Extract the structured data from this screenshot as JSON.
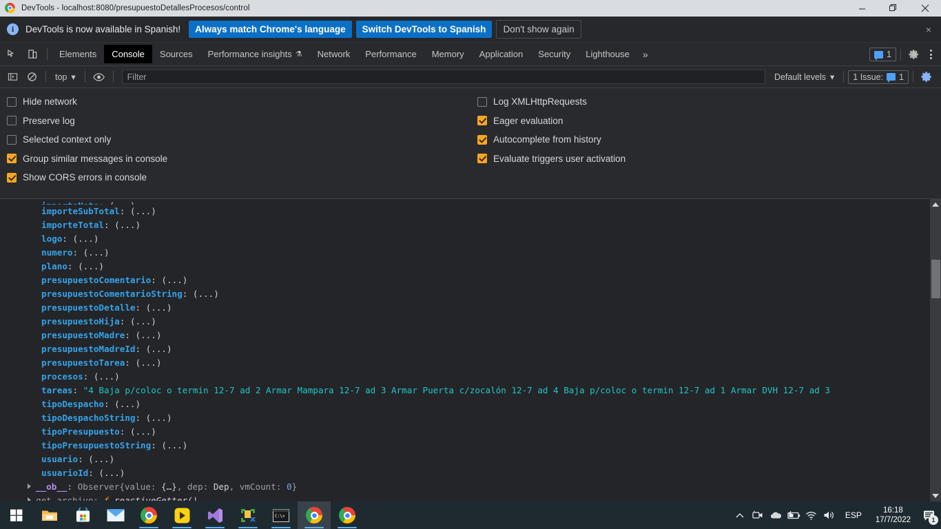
{
  "window": {
    "title": "DevTools - localhost:8080/presupuestoDetallesProcesos/control",
    "minimize_label": "Minimize",
    "restore_label": "Restore",
    "close_label": "Close"
  },
  "banner": {
    "icon": "info-icon",
    "message": "DevTools is now available in Spanish!",
    "primary_button": "Always match Chrome's language",
    "secondary_button": "Switch DevTools to Spanish",
    "dismiss_button": "Don't show again",
    "close_label": "×"
  },
  "tabbar": {
    "inspect_icon": "inspect-element-icon",
    "device_icon": "device-toolbar-icon",
    "tabs": [
      {
        "label": "Elements",
        "active": false
      },
      {
        "label": "Console",
        "active": true
      },
      {
        "label": "Sources",
        "active": false
      },
      {
        "label": "Performance insights",
        "active": false,
        "badge": "⚗"
      },
      {
        "label": "Network",
        "active": false
      },
      {
        "label": "Performance",
        "active": false
      },
      {
        "label": "Memory",
        "active": false
      },
      {
        "label": "Application",
        "active": false
      },
      {
        "label": "Security",
        "active": false
      },
      {
        "label": "Lighthouse",
        "active": false
      }
    ],
    "more_tabs": "»",
    "issue_count": "1",
    "settings_icon": "gear-icon",
    "more_options_icon": "kebab-menu-icon"
  },
  "console_toolbar": {
    "sidebar_icon": "console-sidebar-icon",
    "clear_icon": "clear-console-icon",
    "context": "top",
    "context_caret": "▾",
    "eye_icon": "live-expression-eye-icon",
    "filter_placeholder": "Filter",
    "filter_value": "",
    "levels_label": "Default levels",
    "levels_caret": "▾",
    "issues_label": "1 Issue:",
    "issues_count": "1",
    "settings_icon": "console-settings-gear-icon"
  },
  "settings_panel": {
    "left_column": [
      {
        "label": "Hide network",
        "checked": false
      },
      {
        "label": "Preserve log",
        "checked": false
      },
      {
        "label": "Selected context only",
        "checked": false
      },
      {
        "label": "Group similar messages in console",
        "checked": true
      },
      {
        "label": "Show CORS errors in console",
        "checked": true
      }
    ],
    "right_column": [
      {
        "label": "Log XMLHttpRequests",
        "checked": false
      },
      {
        "label": "Eager evaluation",
        "checked": true
      },
      {
        "label": "Autocomplete from history",
        "checked": true
      },
      {
        "label": "Evaluate triggers user activation",
        "checked": true
      }
    ]
  },
  "console_output": {
    "properties": [
      "importeSubTotal",
      "importeTotal",
      "logo",
      "numero",
      "plano",
      "presupuestoComentario",
      "presupuestoComentarioString",
      "presupuestoDetalle",
      "presupuestoHija",
      "presupuestoMadre",
      "presupuestoMadreId",
      "presupuestoTarea",
      "procesos"
    ],
    "collapsed_value": "(...)",
    "tareas_key": "tareas",
    "tareas_value": "\"4 Baja p/coloc o termin 12-7 ad 2 Armar Mampara 12-7 ad 3 Armar Puerta c/zocalón 12-7 ad 4 Baja p/coloc o termin 12-7 ad 1 Armar DVH 12-7 ad 3",
    "properties_after": [
      "tipoDespacho",
      "tipoDespachoString",
      "tipoPresupuesto",
      "tipoPresupuestoString",
      "usuario",
      "usuarioId"
    ],
    "observer_line": {
      "key": "__ob__",
      "class_name": "Observer",
      "body_open": "{value: ",
      "value_obj": "{…}",
      "dep_key": ", dep: ",
      "dep_val": "Dep",
      "vm_key": ", vmCount: ",
      "vm_val": "0",
      "body_close": "}"
    },
    "getter_line": {
      "key": "get archivo:",
      "fn_keyword": "f",
      "fn_name": "reactiveGetter()"
    },
    "colors": {
      "property": "#35a3e8",
      "string": "#20c5c5",
      "number": "#7aa6f0",
      "observer": "#b58cf0",
      "punctuation": "#cfd2d4",
      "background": "#242529"
    }
  },
  "taskbar": {
    "items": [
      {
        "name": "start-button",
        "running": false
      },
      {
        "name": "file-explorer",
        "running": false
      },
      {
        "name": "microsoft-store",
        "running": false
      },
      {
        "name": "mail",
        "running": false
      },
      {
        "name": "chrome-1",
        "running": true
      },
      {
        "name": "app-yellow",
        "running": true
      },
      {
        "name": "visual-studio",
        "running": true
      },
      {
        "name": "snipping-tool",
        "running": true
      },
      {
        "name": "command-prompt",
        "running": true
      },
      {
        "name": "chrome-2",
        "running": true,
        "active": true
      },
      {
        "name": "chrome-3",
        "running": true
      }
    ],
    "tray": {
      "show_hidden": "∧",
      "camera_icon": "camera-icon",
      "onedrive_icon": "onedrive-cloud-icon",
      "battery_icon": "battery-charging-icon",
      "wifi_icon": "wifi-icon",
      "volume_icon": "speaker-icon",
      "language": "ESP",
      "time": "16:18",
      "date": "17/7/2022",
      "notifications_icon": "notifications-icon",
      "notifications_count": "1"
    }
  }
}
